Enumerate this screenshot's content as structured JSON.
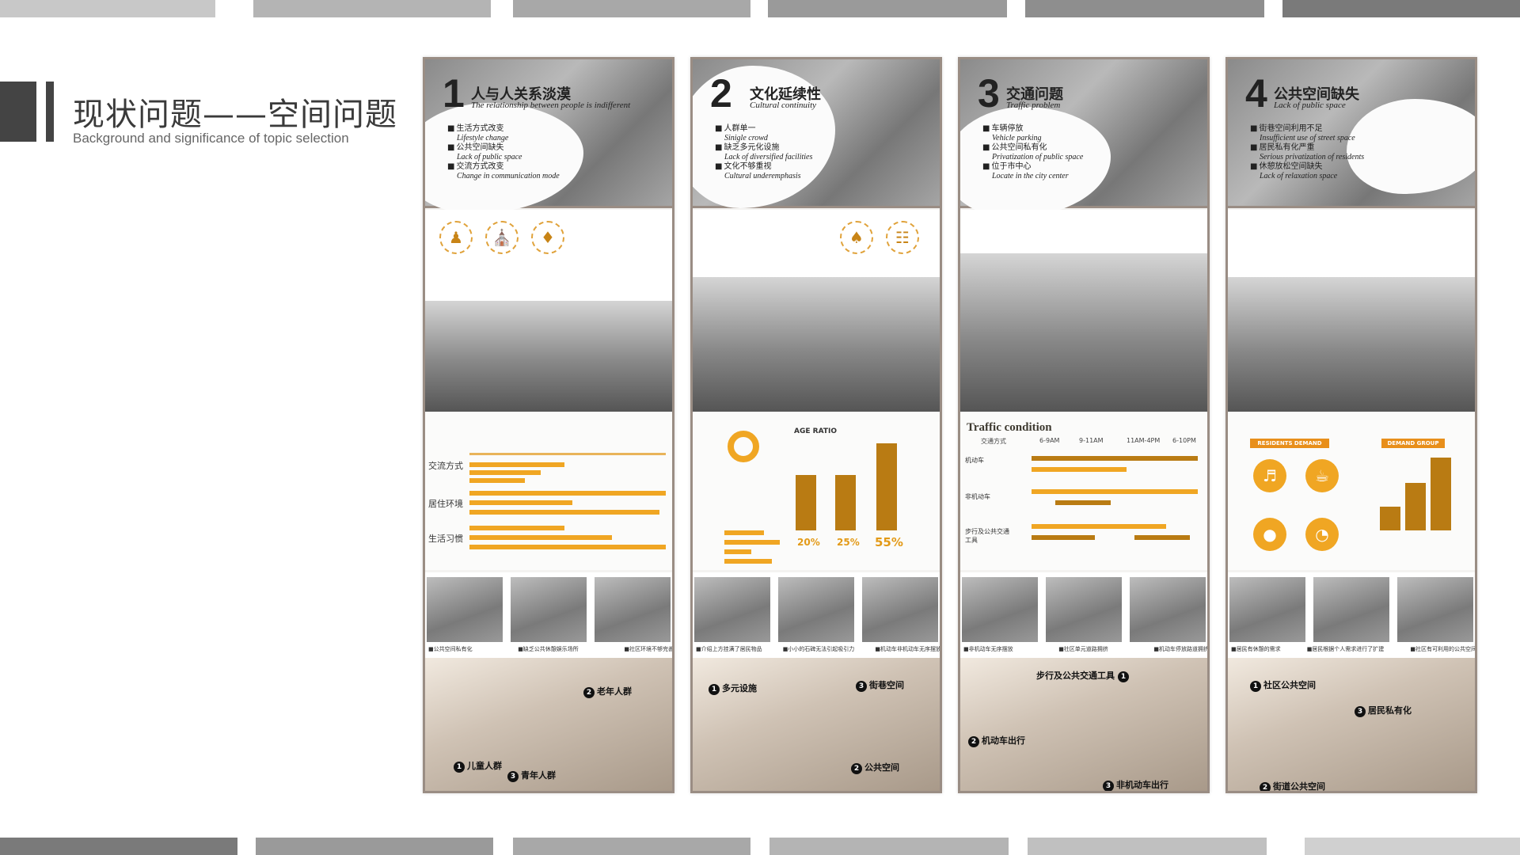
{
  "page": {
    "title": "现状问题——空间问题",
    "subtitle": "Background and significance of topic selection"
  },
  "panels": [
    {
      "num": "1",
      "title_cn": "人与人关系淡漠",
      "title_en": "The relationship between people is indifferent",
      "bullets": [
        {
          "cn": "生活方式改变",
          "en": "Lifestyle change"
        },
        {
          "cn": "公共空间缺失",
          "en": "Lack of public space"
        },
        {
          "cn": "交流方式改变",
          "en": "Change in communication mode"
        }
      ],
      "chart_labels": [
        "交流方式",
        "居住环境",
        "生活习惯"
      ],
      "captions": [
        "■公共空间私有化",
        "■缺乏公共休憩娱乐场所",
        "■社区环境不够完善"
      ],
      "tags": [
        "儿童人群",
        "老年人群",
        "青年人群"
      ]
    },
    {
      "num": "2",
      "title_cn": "文化延续性",
      "title_en": "Cultural continuity",
      "bullets": [
        {
          "cn": "人群单一",
          "en": "Sinigle crowd"
        },
        {
          "cn": "缺乏多元化设施",
          "en": "Lack of diversified facilities"
        },
        {
          "cn": "文化不够重视",
          "en": "Cultural underemphasis"
        }
      ],
      "chart_title": "AGE RATIO",
      "percents": [
        "20%",
        "25%",
        "55%"
      ],
      "captions": [
        "■介绍上方挂满了居民物品",
        "■小小的石碑无法引起吸引力",
        "■机动车非机动车无序摆放"
      ],
      "tags": [
        "多元设施",
        "街巷空间",
        "公共空间"
      ]
    },
    {
      "num": "3",
      "title_cn": "交通问题",
      "title_en": "Traffic problem",
      "bullets": [
        {
          "cn": "车辆停放",
          "en": "Vehicle parking"
        },
        {
          "cn": "公共空间私有化",
          "en": "Privatization of public space"
        },
        {
          "cn": "位于市中心",
          "en": "Locate in the city center"
        }
      ],
      "chart_title": "Traffic condition",
      "time_heads": [
        "交通方式",
        "6-9AM",
        "9-11AM",
        "11AM-4PM",
        "6-10PM"
      ],
      "modes": [
        "机动车",
        "非机动车",
        "步行及公共交通工具"
      ],
      "captions": [
        "■非机动车无序摆放",
        "■社区单元道路拥挤",
        "■机动车停放路道拥挤"
      ],
      "tags": [
        "步行及公共交通工具",
        "机动车出行",
        "非机动车出行"
      ]
    },
    {
      "num": "4",
      "title_cn": "公共空间缺失",
      "title_en": "Lack of public space",
      "bullets": [
        {
          "cn": "街巷空间利用不足",
          "en": "Insufficient use of street space"
        },
        {
          "cn": "居民私有化严重",
          "en": "Serious privatization of residents"
        },
        {
          "cn": "休憩放松空间缺失",
          "en": "Lack of relaxation space"
        }
      ],
      "demand_labels": [
        "RESIDENTS DEMAND",
        "DEMAND GROUP"
      ],
      "captions": [
        "■居民有休憩的需求",
        "■居民根据个人需求进行了扩建",
        "■社区有可利用的公共空间"
      ],
      "tags": [
        "社区公共空间",
        "居民私有化",
        "街道公共空间"
      ]
    }
  ],
  "colors": {
    "accent": "#f0a623",
    "dark_accent": "#b97b13",
    "frame": "#9a8d84",
    "title_mark": "#444444"
  }
}
